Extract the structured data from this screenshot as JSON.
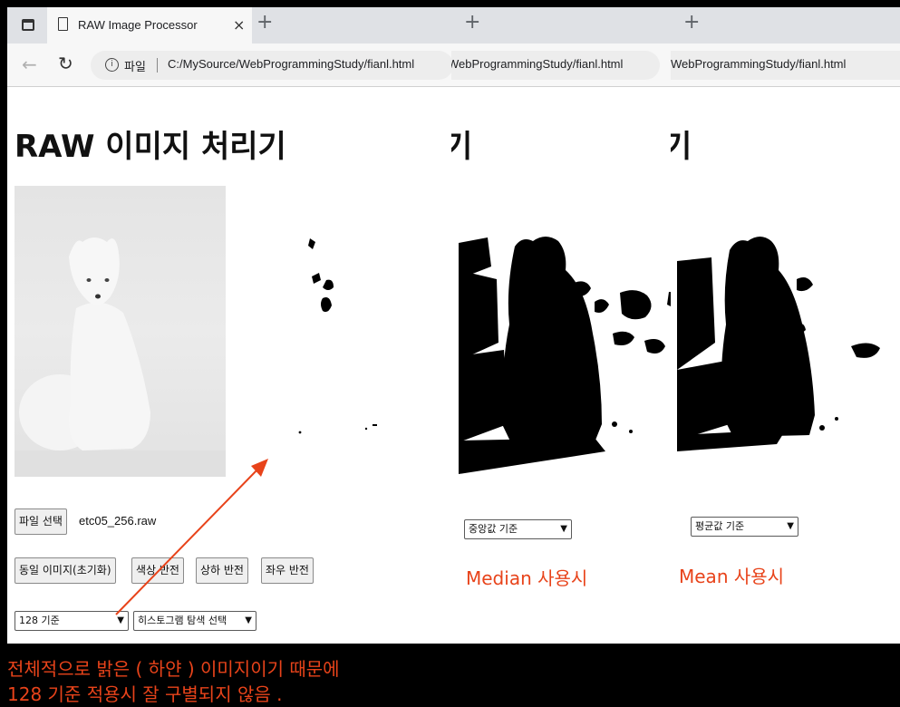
{
  "browser": {
    "tab_title": "RAW Image Processor",
    "close_glyph": "×",
    "new_tab_glyph": "+",
    "info_label": "파일",
    "url": "C:/MySource/WebProgrammingStudy/fianl.html",
    "url_partial": "WebProgrammingStudy/fianl.html",
    "url_partial_2": "WebProgrammingStudy/fianl.html"
  },
  "page": {
    "title": "RAW 이미지 처리기",
    "title_fragment": "기"
  },
  "file": {
    "button_label": "파일 선택",
    "filename": "etc05_256.raw"
  },
  "toolbar": {
    "buttons": [
      "동일 이미지(초기화)",
      "색상 반전",
      "상하 반전",
      "좌우 반전"
    ]
  },
  "threshold_select": {
    "value": "128 기준"
  },
  "histogram_select": {
    "value": "히스토그램 탐색 선택"
  },
  "median_select": {
    "value": "중앙값 기준"
  },
  "mean_select": {
    "value": "평균값 기준"
  },
  "annotations": {
    "median_caption": "Median  사용시",
    "mean_caption": "Mean  사용시",
    "note_line1": "전체적으로 밝은 ( 하얀 )  이미지이기 때문에",
    "note_line2": "128  기준  적용시  잘  구별되지  않음 ."
  },
  "colors": {
    "accent_annotation": "#e8431a",
    "tab_strip": "#dfe1e5",
    "toolbar_bg": "#f7f7f7"
  },
  "icons": [
    "window-icon",
    "page-icon",
    "close-icon",
    "new-tab-icon",
    "back-icon",
    "reload-icon",
    "info-icon"
  ]
}
